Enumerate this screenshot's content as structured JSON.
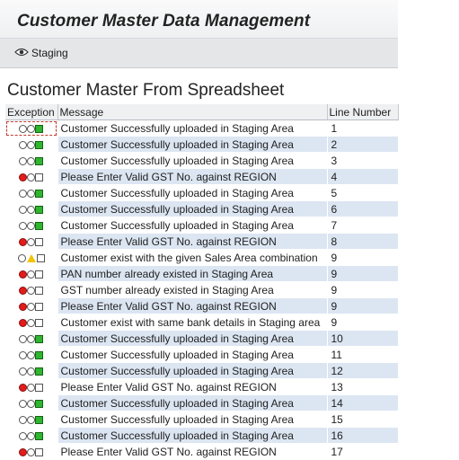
{
  "app": {
    "title": "Customer Master Data Management"
  },
  "toolbar": {
    "staging_label": "Staging",
    "staging_icon": "eye-icon"
  },
  "section": {
    "title": "Customer Master From Spreadsheet"
  },
  "grid": {
    "columns": {
      "exception": "Exception",
      "message": "Message",
      "line_number": "Line Number"
    },
    "rows": [
      {
        "status": "success",
        "message": "Customer Successfully uploaded in Staging Area",
        "line": "1"
      },
      {
        "status": "success",
        "message": "Customer Successfully uploaded in Staging Area",
        "line": "2"
      },
      {
        "status": "success",
        "message": "Customer Successfully uploaded in Staging Area",
        "line": "3"
      },
      {
        "status": "error",
        "message": "Please Enter Valid GST No. against REGION",
        "line": "4"
      },
      {
        "status": "success",
        "message": "Customer Successfully uploaded in Staging Area",
        "line": "5"
      },
      {
        "status": "success",
        "message": "Customer Successfully uploaded in Staging Area",
        "line": "6"
      },
      {
        "status": "success",
        "message": "Customer Successfully uploaded in Staging Area",
        "line": "7"
      },
      {
        "status": "error",
        "message": "Please Enter Valid GST No. against REGION",
        "line": "8"
      },
      {
        "status": "warning",
        "message": "Customer exist with the given Sales Area combination",
        "line": "9"
      },
      {
        "status": "error",
        "message": "PAN number already existed in Staging Area",
        "line": "9"
      },
      {
        "status": "error",
        "message": "GST number already existed in Staging Area",
        "line": "9"
      },
      {
        "status": "error",
        "message": "Please Enter Valid GST No. against REGION",
        "line": "9"
      },
      {
        "status": "error",
        "message": "Customer exist with same bank details in Staging area",
        "line": "9"
      },
      {
        "status": "success",
        "message": "Customer Successfully uploaded in Staging Area",
        "line": "10"
      },
      {
        "status": "success",
        "message": "Customer Successfully uploaded in Staging Area",
        "line": "11"
      },
      {
        "status": "success",
        "message": "Customer Successfully uploaded in Staging Area",
        "line": "12"
      },
      {
        "status": "error",
        "message": "Please Enter Valid GST No. against REGION",
        "line": "13"
      },
      {
        "status": "success",
        "message": "Customer Successfully uploaded in Staging Area",
        "line": "14"
      },
      {
        "status": "success",
        "message": "Customer Successfully uploaded in Staging Area",
        "line": "15"
      },
      {
        "status": "success",
        "message": "Customer Successfully uploaded in Staging Area",
        "line": "16"
      },
      {
        "status": "error",
        "message": "Please Enter Valid GST No. against REGION",
        "line": "17"
      }
    ]
  },
  "colors": {
    "error": "#e31b1b",
    "warning": "#f2c400",
    "success": "#2fb52f",
    "row_alt": "#dce6f2"
  }
}
